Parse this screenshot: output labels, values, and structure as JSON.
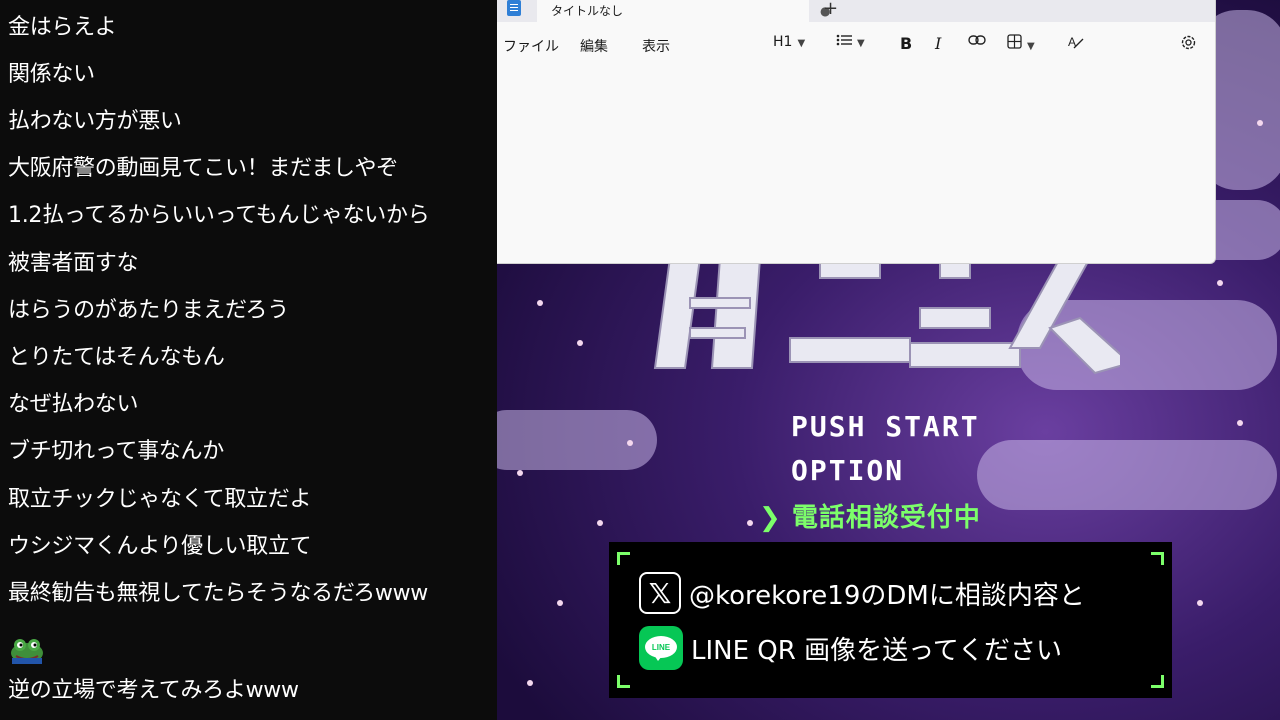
{
  "chat": {
    "messages": [
      "金はらえよ",
      "関係ない",
      "払わない方が悪い",
      "大阪府警の動画見てこい！まだましやぞ",
      "1.2払ってるからいいってもんじゃないから",
      "被害者面すな",
      "はらうのがあたりまえだろう",
      "とりたてはそんなもん",
      "なぜ払わない",
      "ブチ切れって事なんか",
      "取立チックじゃなくて取立だよ",
      "ウシジマくんより優しい取立て",
      "最終勧告も無視してたらそうなるだろwww",
      "逆の立場で考えてみろよwww"
    ],
    "stamp_icon": "frog-stamp-icon"
  },
  "notepad": {
    "tab_title": "タイトルなし",
    "tab_status": "●",
    "new_tab": "+",
    "menus": [
      "ファイル",
      "編集",
      "表示"
    ],
    "heading_tool": "H1",
    "bold": "B",
    "italic": "I",
    "editor_text": ""
  },
  "game": {
    "menu": [
      "PUSH START",
      "OPTION"
    ],
    "active_item": "電話相談受付中",
    "cursor": "❯",
    "panel": {
      "line1": "@korekore19のDMに相談内容と",
      "line2": "LINE QR 画像を送ってください",
      "x_icon": "𝕏",
      "line_icon_text": "LINE"
    },
    "colors": {
      "accent": "#7cff6a",
      "background": "#3a1d6a"
    }
  }
}
